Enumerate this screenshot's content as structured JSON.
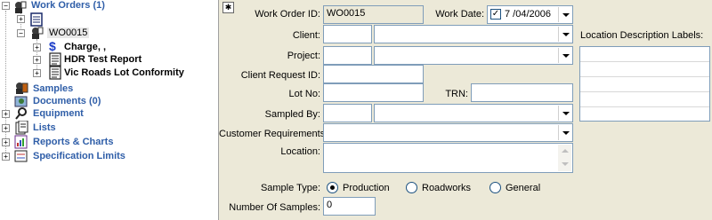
{
  "tree": {
    "work_orders": "Work Orders (1)",
    "wo_item": "WO0015",
    "charge": "Charge, ,",
    "hdr_report": "HDR Test Report",
    "vic_roads": "Vic Roads Lot Conformity",
    "samples": "Samples",
    "documents": "Documents (0)",
    "equipment": "Equipment",
    "lists": "Lists",
    "reports": "Reports & Charts",
    "spec_limits": "Specification Limits"
  },
  "form": {
    "work_order_id_label": "Work Order ID:",
    "work_order_id_value": "WO0015",
    "work_date_label": "Work Date:",
    "work_date_checked": true,
    "work_date_value": "7 /04/2006",
    "client_label": "Client:",
    "project_label": "Project:",
    "client_request_label": "Client Request ID:",
    "lot_no_label": "Lot No:",
    "trn_label": "TRN:",
    "sampled_by_label": "Sampled By:",
    "customer_req_label": "Customer Requirements:",
    "location_label": "Location:",
    "location_desc_label": "Location Description Labels:",
    "sample_type_label": "Sample Type:",
    "sample_type_options": [
      "Production",
      "Roadworks",
      "General"
    ],
    "sample_type_selected": "Production",
    "num_samples_label": "Number Of Samples:",
    "num_samples_value": "0"
  },
  "icons": {
    "pin": "pin-icon",
    "tree_folder": "folder-icon"
  }
}
